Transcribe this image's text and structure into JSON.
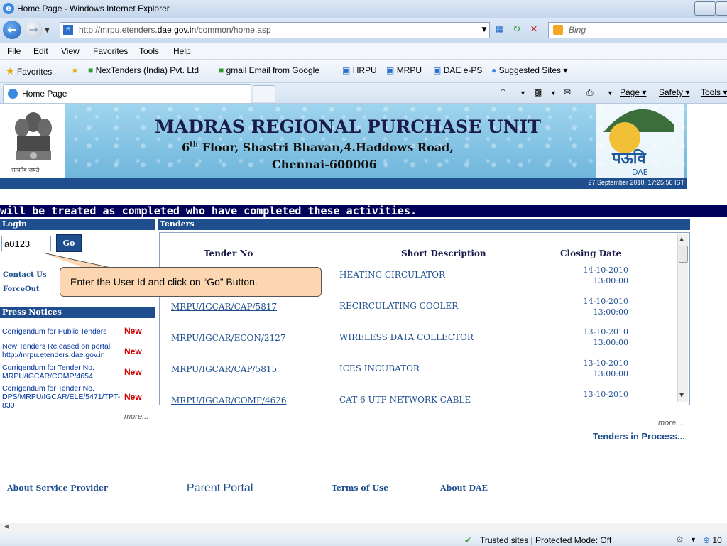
{
  "window": {
    "title": "Home Page - Windows Internet Explorer"
  },
  "address": {
    "url_prefix": "http://mrpu.etenders.",
    "url_domain": "dae.gov.in",
    "url_path": "/common/home.asp",
    "search_placeholder": "Bing"
  },
  "menu": {
    "items": [
      "File",
      "Edit",
      "View",
      "Favorites",
      "Tools",
      "Help"
    ]
  },
  "favorites": {
    "label": "Favorites",
    "items": [
      "NexTenders (India) Pvt. Ltd",
      "gmail Email from Google",
      "HRPU",
      "MRPU",
      "DAE e-PS",
      "Suggested Sites ▾"
    ]
  },
  "tab": {
    "label": "Home Page"
  },
  "commands": {
    "page": "Page ▾",
    "safety": "Safety ▾",
    "tools": "Tools ▾"
  },
  "banner": {
    "title": "MADRAS REGIONAL PURCHASE UNIT",
    "line2_floor": "6",
    "line2_sup": "th",
    "line2_rest": " Floor, Shastri Bhavan,4.Haddows Road,",
    "line3": "Chennai-600006",
    "emblem_caption": "सत्यमेव जयते",
    "logo_text": "पऊवि",
    "logo_sub": "DAE",
    "datetime": "27 September 2010,  17:25:56  IST"
  },
  "marquee": {
    "text": " will be treated as completed who have completed these activities."
  },
  "login": {
    "header": "Login",
    "user_id": "a0123",
    "go_label": "Go"
  },
  "left_links": {
    "contact": "Contact Us",
    "forceout": "ForceOut"
  },
  "press": {
    "header": "Press Notices",
    "notices": [
      {
        "text": "Corrigendum for Public Tenders",
        "badge": "New"
      },
      {
        "text": "New Tenders Released on portal http://mrpu.etenders.dae.gov.in",
        "badge": "New"
      },
      {
        "text": "Corrigendum for Tender No. MRPU/IGCAR/COMP/4654",
        "badge": "New"
      },
      {
        "text": "Corrigendum for Tender No. DPS/MRPU/IGCAR/ELE/5471/TPT-830",
        "badge": "New"
      }
    ],
    "more": "more..."
  },
  "tenders": {
    "header": "Tenders",
    "columns": [
      "Tender No",
      "Short Description",
      "Closing Date"
    ],
    "rows": [
      {
        "no": "",
        "desc": "HEATING CIRCULATOR",
        "date": "14-10-2010",
        "time": "13:00:00"
      },
      {
        "no": "MRPU/IGCAR/CAP/5817",
        "desc": "RECIRCULATING COOLER",
        "date": "14-10-2010",
        "time": "13:00:00"
      },
      {
        "no": "MRPU/IGCAR/ECON/2127",
        "desc": "WIRELESS DATA COLLECTOR",
        "date": "13-10-2010",
        "time": "13:00:00"
      },
      {
        "no": "MRPU/IGCAR/CAP/5815",
        "desc": "ICES INCUBATOR",
        "date": "13-10-2010",
        "time": "13:00:00"
      },
      {
        "no": "MRPU/IGCAR/COMP/4626",
        "desc": "CAT 6 UTP NETWORK CABLE",
        "date": "13-10-2010",
        "time": ""
      }
    ],
    "more": "more...",
    "in_process": "Tenders in Process..."
  },
  "footer": {
    "about_provider": "About Service Provider",
    "parent_portal": "Parent Portal",
    "terms": "Terms of Use",
    "about_dae": "About DAE"
  },
  "callout": {
    "text": "Enter the User Id  and click on “Go” Button."
  },
  "status": {
    "zone": "Trusted sites | Protected Mode: Off",
    "zoom": "10"
  },
  "colors": {
    "accent_blue": "#1f4e8e",
    "marquee_bg": "#00005a",
    "new_badge": "#d00000",
    "callout_bg": "#fcd6b0"
  }
}
